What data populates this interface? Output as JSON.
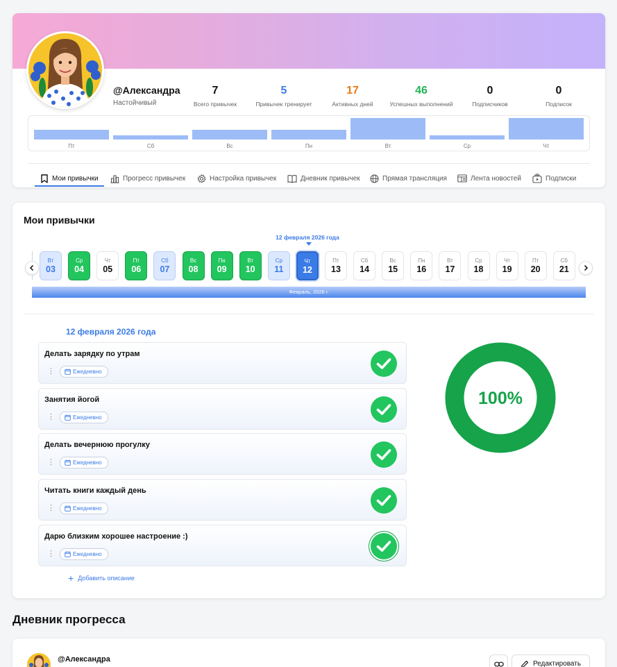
{
  "profile": {
    "username": "@Александра",
    "status": "Настойчивый",
    "stats": [
      {
        "value": "7",
        "label": "Всего привычек",
        "color": "#111111"
      },
      {
        "value": "5",
        "label": "Привычек тренирует",
        "color": "#3b7be6"
      },
      {
        "value": "17",
        "label": "Активных дней",
        "color": "#ea7a14"
      },
      {
        "value": "46",
        "label": "Успешных выполнений",
        "color": "#22b455"
      },
      {
        "value": "0",
        "label": "Подписчиков",
        "color": "#111111"
      },
      {
        "value": "0",
        "label": "Подписок",
        "color": "#111111"
      }
    ],
    "week_activity": {
      "days": [
        "Пт",
        "Сб",
        "Вс",
        "Пн",
        "Вт",
        "Ср",
        "Чт"
      ],
      "levels": [
        0.45,
        0.2,
        0.45,
        0.45,
        1.0,
        0.2,
        1.0
      ]
    }
  },
  "tabs": [
    {
      "label": "Мои привычки",
      "icon": "bookmark-icon",
      "active": true
    },
    {
      "label": "Прогресс привычек",
      "icon": "bar-chart-icon"
    },
    {
      "label": "Настройка привычек",
      "icon": "gear-icon"
    },
    {
      "label": "Дневник привычек",
      "icon": "book-icon"
    },
    {
      "label": "Прямая трансляция",
      "icon": "globe-icon"
    },
    {
      "label": "Лента новостей",
      "icon": "news-icon"
    },
    {
      "label": "Подписки",
      "icon": "subscriptions-icon"
    }
  ],
  "habits_card": {
    "title": "Мои привычки",
    "selected_date": "12 февраля 2026 года",
    "month_label": "Февраль, 2026 г.",
    "calendar": [
      {
        "dow": "Вт",
        "day": "03",
        "state": "light"
      },
      {
        "dow": "Ср",
        "day": "04",
        "state": "green"
      },
      {
        "dow": "Чт",
        "day": "05",
        "state": "none"
      },
      {
        "dow": "Пт",
        "day": "06",
        "state": "green"
      },
      {
        "dow": "Сб",
        "day": "07",
        "state": "light"
      },
      {
        "dow": "Вс",
        "day": "08",
        "state": "green"
      },
      {
        "dow": "Пн",
        "day": "09",
        "state": "green"
      },
      {
        "dow": "Вт",
        "day": "10",
        "state": "green"
      },
      {
        "dow": "Ср",
        "day": "11",
        "state": "light"
      },
      {
        "dow": "Чт",
        "day": "12",
        "state": "selected"
      },
      {
        "dow": "Пт",
        "day": "13",
        "state": "none"
      },
      {
        "dow": "Сб",
        "day": "14",
        "state": "none"
      },
      {
        "dow": "Вс",
        "day": "15",
        "state": "none"
      },
      {
        "dow": "Пн",
        "day": "16",
        "state": "none"
      },
      {
        "dow": "Вт",
        "day": "17",
        "state": "none"
      },
      {
        "dow": "Ср",
        "day": "18",
        "state": "none"
      },
      {
        "dow": "Чт",
        "day": "19",
        "state": "none"
      },
      {
        "dow": "Пт",
        "day": "20",
        "state": "none"
      },
      {
        "dow": "Сб",
        "day": "21",
        "state": "none"
      }
    ],
    "date_heading": "12 февраля 2026 года",
    "habits": [
      {
        "name": "Делать зарядку по утрам",
        "frequency": "Ежедневно",
        "done": true
      },
      {
        "name": "Занятия йогой",
        "frequency": "Ежедневно",
        "done": true
      },
      {
        "name": "Делать вечернюю прогулку",
        "frequency": "Ежедневно",
        "done": true
      },
      {
        "name": "Читать книги каждый день",
        "frequency": "Ежедневно",
        "done": true
      },
      {
        "name": "Дарю близким хорошее настроение :)",
        "frequency": "Ежедневно",
        "done": true
      }
    ],
    "add_description": "Добавить описание",
    "completion_percent": 100,
    "completion_label": "100%",
    "colors": {
      "done": "#22c55e",
      "ring": "#16a34a",
      "accent": "#3b7be6"
    }
  },
  "diary": {
    "title": "Дневник прогресса",
    "username": "@Александра",
    "edit_label": "Редактировать"
  }
}
